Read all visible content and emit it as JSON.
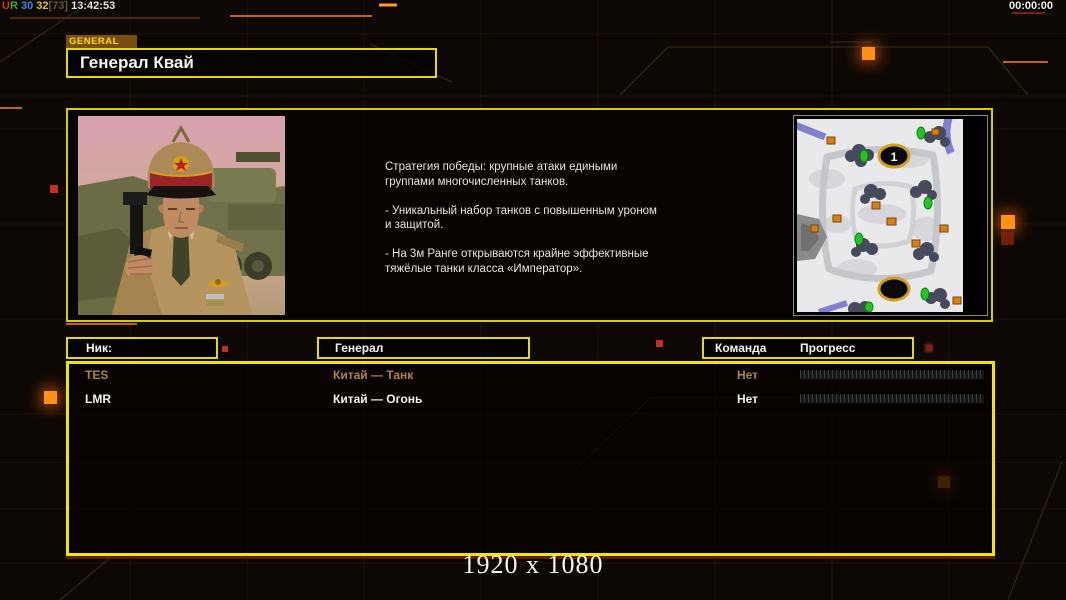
{
  "hud": {
    "left": {
      "u": "U",
      "r": "R",
      "val1": "30",
      "val2": "32",
      "val3": "[73]",
      "clock": "13:42:53"
    },
    "match_timer": "00:00:00"
  },
  "header": {
    "tab_label": "GENERAL",
    "title": "Генерал Квай"
  },
  "briefing": {
    "strategy_text": "Стратегия победы: крупные атаки едиными\n группами многочисленных танков.\n\n- Уникальный набор танков с повышенным уроном\n и защитой.\n\n- На 3м Ранге открываются крайне эффективные\n тяжёлые танки класса «Император».",
    "minimap": {
      "start_marker_top": "1"
    }
  },
  "roster": {
    "columns": {
      "nick": "Ник:",
      "general": "Генерал",
      "team": "Команда",
      "progress": "Прогресс"
    },
    "rows": [
      {
        "nick": "TES",
        "general": "Китай — Танк",
        "team": "Нет",
        "progress_percent": 0
      },
      {
        "nick": "LMR",
        "general": "Китай — Огонь",
        "team": "Нет",
        "progress_percent": 0
      }
    ]
  },
  "footer": {
    "resolution_label": "1920 x 1080"
  },
  "colors": {
    "accent_yellow": "#f0e000",
    "accent_orange": "#ff9012",
    "alert_red": "#c23024",
    "row_muted_gold": "#b08440",
    "row_active_white": "#f2f2f2"
  }
}
